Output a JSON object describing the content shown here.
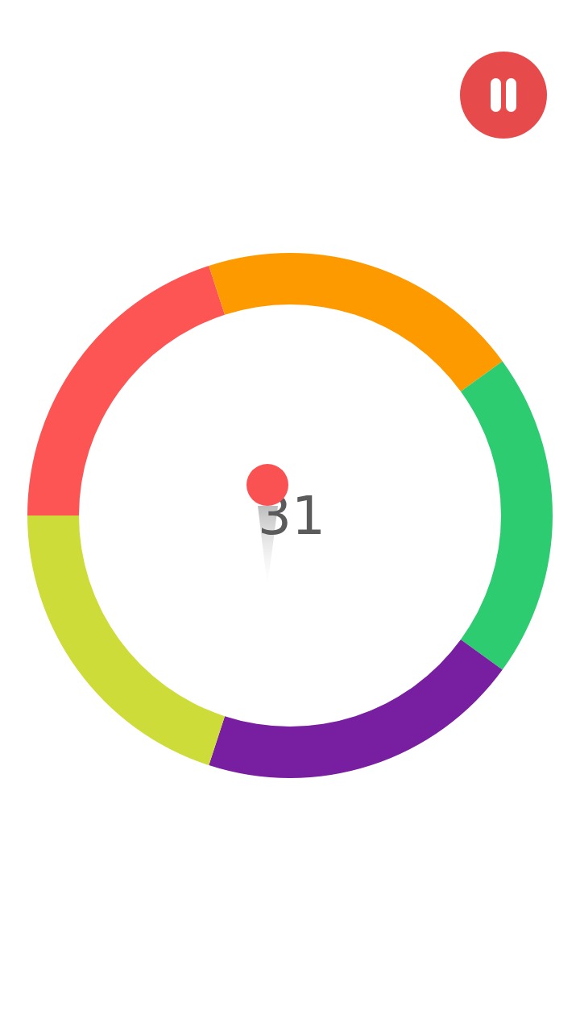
{
  "score": "31",
  "ball": {
    "color": "#fa5252"
  },
  "ring": {
    "segments": [
      {
        "color": "#fd5454"
      },
      {
        "color": "#fd9a00"
      },
      {
        "color": "#2ecc71"
      },
      {
        "color": "#781ea0"
      },
      {
        "color": "#cddc39"
      }
    ]
  }
}
